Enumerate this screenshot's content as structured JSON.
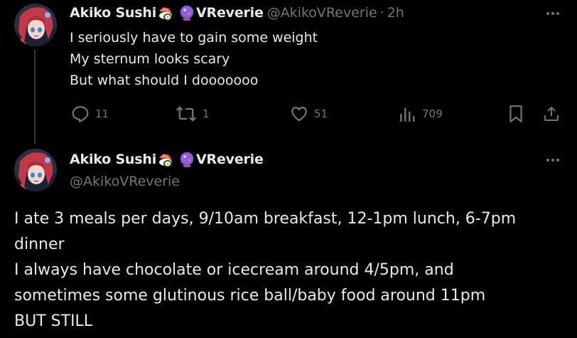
{
  "tweets": [
    {
      "author": {
        "name": "Akiko Sushi",
        "name_suffix": "VReverie",
        "handle": "@AkikoVReverie",
        "separator": "·",
        "time": "2h",
        "avatar_icon": "anime-avatar-red-hair",
        "emojis": [
          "sushi-emoji-icon",
          "crystal-ball-emoji-icon"
        ]
      },
      "lines": [
        "I seriously have to gain some weight",
        "My sternum looks scary",
        "But what should I dooooooo"
      ],
      "stats": {
        "replies": "11",
        "reposts": "1",
        "likes": "51",
        "views": "709"
      }
    },
    {
      "author": {
        "name": "Akiko Sushi",
        "name_suffix": "VReverie",
        "handle": "@AkikoVReverie",
        "avatar_icon": "anime-avatar-red-hair",
        "emojis": [
          "sushi-emoji-icon",
          "crystal-ball-emoji-icon"
        ]
      },
      "lines": [
        "I ate 3 meals per days, 9/10am breakfast, 12-1pm lunch, 6-7pm",
        "dinner",
        "I always have chocolate or icecream around 4/5pm, and",
        "sometimes some glutinous rice ball/baby food around 11pm",
        "BUT STILL"
      ]
    }
  ],
  "colors": {
    "background": "#000000",
    "text": "#e7e9ea",
    "secondary": "#71767b",
    "divider": "#333639"
  }
}
